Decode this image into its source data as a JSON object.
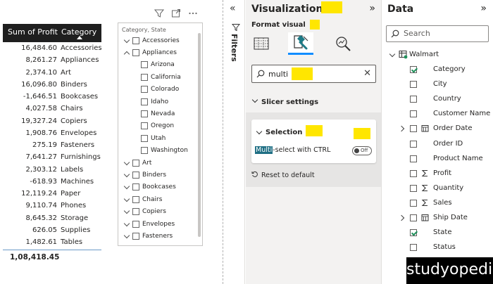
{
  "table": {
    "headers": [
      "Sum of Profit",
      "Category"
    ],
    "rows": [
      [
        "16,484.60",
        "Accessories"
      ],
      [
        "8,261.27",
        "Appliances"
      ],
      [
        "2,374.10",
        "Art"
      ],
      [
        "16,096.80",
        "Binders"
      ],
      [
        "-1,646.51",
        "Bookcases"
      ],
      [
        "4,027.58",
        "Chairs"
      ],
      [
        "19,327.24",
        "Copiers"
      ],
      [
        "1,908.76",
        "Envelopes"
      ],
      [
        "275.19",
        "Fasteners"
      ],
      [
        "7,641.27",
        "Furnishings"
      ],
      [
        "2,303.12",
        "Labels"
      ],
      [
        "-618.93",
        "Machines"
      ],
      [
        "12,119.24",
        "Paper"
      ],
      [
        "9,110.74",
        "Phones"
      ],
      [
        "8,645.32",
        "Storage"
      ],
      [
        "626.05",
        "Supplies"
      ],
      [
        "1,482.61",
        "Tables"
      ]
    ],
    "total": "1,08,418.45"
  },
  "slicer": {
    "title": "Category, State",
    "items": [
      {
        "label": "Accessories",
        "level": 0,
        "expanded": false
      },
      {
        "label": "Appliances",
        "level": 0,
        "expanded": true
      },
      {
        "label": "Arizona",
        "level": 1
      },
      {
        "label": "California",
        "level": 1
      },
      {
        "label": "Colorado",
        "level": 1
      },
      {
        "label": "Idaho",
        "level": 1
      },
      {
        "label": "Nevada",
        "level": 1
      },
      {
        "label": "Oregon",
        "level": 1
      },
      {
        "label": "Utah",
        "level": 1
      },
      {
        "label": "Washington",
        "level": 1
      },
      {
        "label": "Art",
        "level": 0,
        "expanded": false
      },
      {
        "label": "Binders",
        "level": 0,
        "expanded": false
      },
      {
        "label": "Bookcases",
        "level": 0,
        "expanded": false
      },
      {
        "label": "Chairs",
        "level": 0,
        "expanded": false
      },
      {
        "label": "Copiers",
        "level": 0,
        "expanded": false
      },
      {
        "label": "Envelopes",
        "level": 0,
        "expanded": false
      },
      {
        "label": "Fasteners",
        "level": 0,
        "expanded": false
      }
    ]
  },
  "filters": {
    "label": "Filters",
    "collapse_glyph": "«"
  },
  "viz": {
    "title": "Visualizations",
    "expand_glyph": "»",
    "format_label": "Format visual",
    "search_value": "multi",
    "clear_glyph": "✕",
    "section_label": "Slicer settings",
    "card_label": "Selection",
    "setting_highlight": "Multi",
    "setting_rest": "-select with CTRL",
    "toggle_label": "Off",
    "reset_label": "Reset to default",
    "highlight_color": "#ffe600",
    "accent_color": "#118dff"
  },
  "data_pane": {
    "title": "Data",
    "expand_glyph": "»",
    "search_placeholder": "Search",
    "table_name": "Walmart",
    "fields": [
      {
        "label": "Category",
        "checked": true,
        "icon": "",
        "expandable": false
      },
      {
        "label": "City",
        "checked": false,
        "icon": "",
        "expandable": false
      },
      {
        "label": "Country",
        "checked": false,
        "icon": "",
        "expandable": false
      },
      {
        "label": "Customer Name",
        "checked": false,
        "icon": "",
        "expandable": false
      },
      {
        "label": "Order Date",
        "checked": false,
        "icon": "calendar-icon",
        "expandable": true
      },
      {
        "label": "Order ID",
        "checked": false,
        "icon": "",
        "expandable": false
      },
      {
        "label": "Product Name",
        "checked": false,
        "icon": "",
        "expandable": false
      },
      {
        "label": "Profit",
        "checked": false,
        "icon": "sigma-icon",
        "expandable": false
      },
      {
        "label": "Quantity",
        "checked": false,
        "icon": "sigma-icon",
        "expandable": false
      },
      {
        "label": "Sales",
        "checked": false,
        "icon": "sigma-icon",
        "expandable": false
      },
      {
        "label": "Ship Date",
        "checked": false,
        "icon": "calendar-icon",
        "expandable": true
      },
      {
        "label": "State",
        "checked": true,
        "icon": "",
        "expandable": false
      },
      {
        "label": "Status",
        "checked": false,
        "icon": "",
        "expandable": false
      }
    ]
  },
  "watermark": "studyopedia"
}
